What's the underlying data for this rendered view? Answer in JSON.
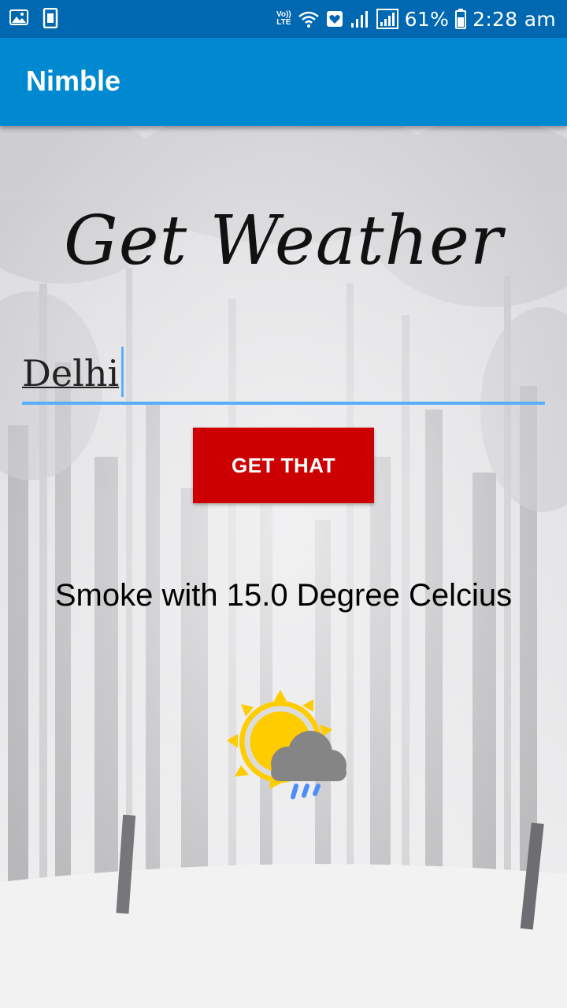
{
  "status_bar": {
    "icons": [
      "gallery-icon",
      "sim-icon",
      "volte-icon",
      "wifi-icon",
      "heart-icon",
      "signal-icon",
      "signal-icon",
      "battery-icon"
    ],
    "volte_top": "Vo))",
    "volte_bottom": "LTE",
    "battery": "61%",
    "time": "2:28 am"
  },
  "app_bar": {
    "title": "Nimble"
  },
  "main": {
    "heading": "Get Weather",
    "city_input": {
      "value": "Delhi"
    },
    "button_label": "GET THAT",
    "result": "Smoke with 15.0 Degree Celcius",
    "weather_icon": "partly-sunny-rain-icon"
  },
  "colors": {
    "status_bar": "#0067b1",
    "app_bar": "#0089d1",
    "button": "#cc0000",
    "input_accent": "#5aaeff",
    "sun": "#ffcc00",
    "cloud": "#858585",
    "rain": "#4d8df5"
  }
}
